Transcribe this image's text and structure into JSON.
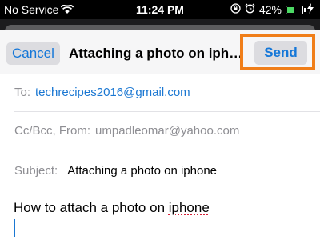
{
  "status_bar": {
    "carrier": "No Service",
    "time": "11:24 PM",
    "battery_percent": "42%",
    "battery_level": 0.42,
    "icons": [
      "wifi-icon",
      "orientation-lock-icon",
      "alarm-icon",
      "battery-icon",
      "charging-bolt-icon"
    ]
  },
  "nav": {
    "cancel_label": "Cancel",
    "title": "Attaching a photo on iphone",
    "send_label": "Send"
  },
  "fields": {
    "to_label": "To:",
    "to_value": "techrecipes2016@gmail.com",
    "ccbcc_label": "Cc/Bcc, From:",
    "from_value": "umpadleomar@yahoo.com",
    "subject_label": "Subject:",
    "subject_value": "Attaching a photo on iphone"
  },
  "body": {
    "text_prefix": "How to attach a photo on ",
    "text_misspelled": "iphone"
  },
  "colors": {
    "accent": "#1577d8",
    "highlight_box": "#f07e19",
    "charging": "#4cd964"
  }
}
